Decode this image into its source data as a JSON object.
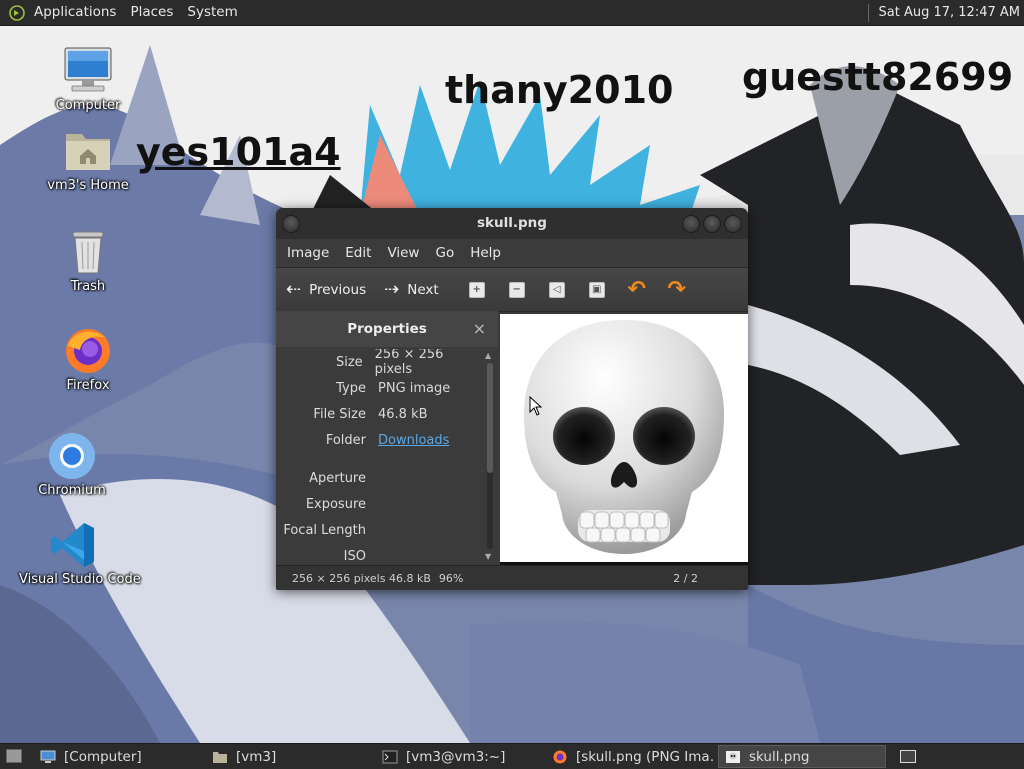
{
  "top_panel": {
    "menus": [
      "Applications",
      "Places",
      "System"
    ],
    "clock": "Sat Aug 17, 12:47 AM"
  },
  "wallpaper": {
    "texts": [
      "thany2010",
      "guestt82699",
      "yes101a4"
    ]
  },
  "desktop_icons": [
    {
      "label": "Computer",
      "icon": "computer-icon"
    },
    {
      "label": "vm3's Home",
      "icon": "home-folder-icon"
    },
    {
      "label": "Trash",
      "icon": "trash-icon"
    },
    {
      "label": "Firefox",
      "icon": "firefox-icon"
    },
    {
      "label": "Chromium",
      "icon": "chromium-icon"
    },
    {
      "label": "Visual Studio Code",
      "icon": "vscode-icon"
    }
  ],
  "viewer": {
    "title": "skull.png",
    "menu": [
      "Image",
      "Edit",
      "View",
      "Go",
      "Help"
    ],
    "toolbar": {
      "previous": "Previous",
      "next": "Next",
      "buttons": [
        "zoom-in-icon",
        "zoom-out-icon",
        "fit-icon",
        "fullscreen-icon",
        "rotate-left-icon",
        "rotate-right-icon"
      ]
    },
    "sidebar": {
      "title": "Properties",
      "close": "×",
      "properties": [
        {
          "key": "Size",
          "value": "256 × 256 pixels"
        },
        {
          "key": "Type",
          "value": "PNG image"
        },
        {
          "key": "File Size",
          "value": "46.8 kB"
        },
        {
          "key": "Folder",
          "value": "Downloads"
        }
      ],
      "exif": [
        {
          "key": "Aperture",
          "value": ""
        },
        {
          "key": "Exposure",
          "value": ""
        },
        {
          "key": "Focal Length",
          "value": ""
        },
        {
          "key": "ISO",
          "value": ""
        }
      ]
    },
    "image": "skull emoji",
    "status": {
      "info": "256 × 256 pixels  46.8 kB",
      "zoom": "96%",
      "position": "2 / 2"
    }
  },
  "taskbar": {
    "tasks": [
      {
        "label": "[Computer]",
        "icon": "computer-icon"
      },
      {
        "label": "[vm3]",
        "icon": "folder-icon"
      },
      {
        "label": "[vm3@vm3:~]",
        "icon": "terminal-icon"
      },
      {
        "label": "[skull.png (PNG Ima…",
        "icon": "firefox-icon"
      },
      {
        "label": "skull.png",
        "icon": "image-viewer-icon"
      }
    ]
  }
}
